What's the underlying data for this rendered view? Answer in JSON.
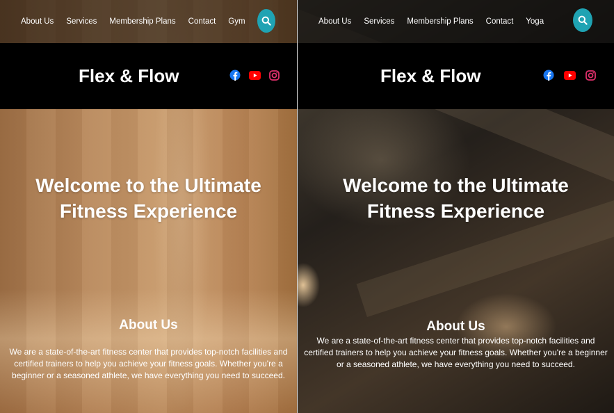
{
  "colors": {
    "accent": "#1fa3b3",
    "facebook": "#1877f2",
    "youtube": "#ff0000",
    "instagram": "#e1306c"
  },
  "left_page": {
    "nav": [
      "About Us",
      "Services",
      "Membership Plans",
      "Contact",
      "Gym"
    ],
    "brand": "Flex & Flow",
    "hero_title": "Welcome to the Ultimate Fitness Experience",
    "about_title": "About Us",
    "about_text": "We are a state-of-the-art fitness center that provides top-notch facilities and certified trainers to help you achieve your fitness goals. Whether you're a beginner or a seasoned athlete, we have everything you need to succeed.",
    "icons": [
      "search-icon",
      "facebook-icon",
      "youtube-icon",
      "instagram-icon"
    ]
  },
  "right_page": {
    "nav": [
      "About Us",
      "Services",
      "Membership Plans",
      "Contact",
      "Yoga"
    ],
    "brand": "Flex & Flow",
    "hero_title": "Welcome to the Ultimate Fitness Experience",
    "about_title": "About Us",
    "about_text": "We are a state-of-the-art fitness center that provides top-notch facilities and certified trainers to help you achieve your fitness goals. Whether you're a beginner or a seasoned athlete, we have everything you need to succeed.",
    "icons": [
      "search-icon",
      "facebook-icon",
      "youtube-icon",
      "instagram-icon"
    ]
  }
}
